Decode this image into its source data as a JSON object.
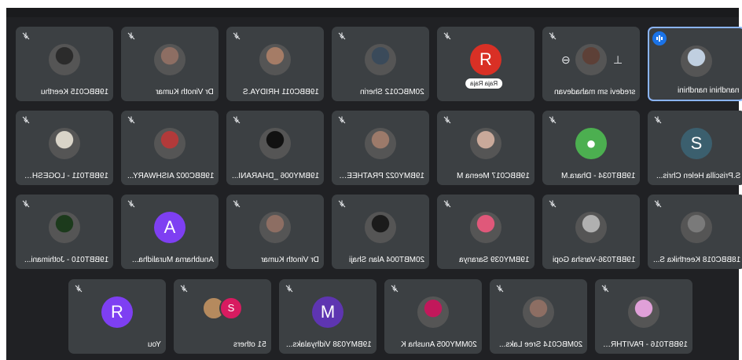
{
  "colors": {
    "tile_bg": "#3c4043",
    "frame_bg": "#202124",
    "speaking_border": "#8ab4f8"
  },
  "rows": [
    [
      {
        "name": "19BBC015 Keerthu",
        "avatar": "photo",
        "tone": "#2b2b2b"
      },
      {
        "name": "Dr Vinoth Kumar",
        "avatar": "photo",
        "tone": "#8d6e63"
      },
      {
        "name": "19BBC011 HRIDYA.S",
        "avatar": "photo",
        "tone": "#a57c66"
      },
      {
        "name": "20MBC012 Sherin",
        "avatar": "photo",
        "tone": "#3a4a5a"
      },
      {
        "name": "",
        "avatar": "letter",
        "letter": "R",
        "letter_color": "#d93025",
        "chip": "Raja Raja"
      },
      {
        "name": "sredevi sm mahadevan",
        "avatar": "photo",
        "tone": "#5d4037",
        "hover": true
      },
      {
        "name": "nandhini nandhini",
        "avatar": "photo",
        "tone": "#c0cfe0",
        "speaking": true
      }
    ],
    [
      {
        "name": "19BBT011 - LOGESHW...",
        "avatar": "photo",
        "tone": "#d9d4c8"
      },
      {
        "name": "19BBC002 AISHWARY...",
        "avatar": "photo",
        "tone": "#b23a3a"
      },
      {
        "name": "19BMY006 _DHARANI...",
        "avatar": "photo",
        "tone": "#111111"
      },
      {
        "name": "19BMY022 PRATHEEP...",
        "avatar": "photo",
        "tone": "#9c7a6a"
      },
      {
        "name": "19BBC017 Meena M",
        "avatar": "photo",
        "tone": "#c9a99a"
      },
      {
        "name": "19BBT034 - Dhara.M",
        "avatar": "letter",
        "letter": "●",
        "letter_color": "#4caf50"
      },
      {
        "name": "S.Priscilla Helen Chris...",
        "avatar": "letter",
        "letter": "S",
        "letter_color": "#3b5f6e"
      }
    ],
    [
      {
        "name": "19BBT010 - Jothimani...",
        "avatar": "photo",
        "tone": "#1c3a1c"
      },
      {
        "name": "Anubharna Muralidha...",
        "avatar": "letter",
        "letter": "A",
        "letter_color": "#7e3ff2"
      },
      {
        "name": "Dr Vinoth Kumar",
        "avatar": "photo",
        "tone": "#8d6e63"
      },
      {
        "name": "20MBT004 Alan Shaji",
        "avatar": "photo",
        "tone": "#1b1b1b"
      },
      {
        "name": "19BMY039 Saranya",
        "avatar": "photo",
        "tone": "#e0587a"
      },
      {
        "name": "19BBT036-Varsha Gopi",
        "avatar": "photo",
        "tone": "#b0b0b0"
      },
      {
        "name": "18BBC018 Keerthika S...",
        "avatar": "photo",
        "tone": "#7a7a7a"
      }
    ],
    [
      {
        "name": "You",
        "avatar": "letter",
        "letter": "R",
        "letter_color": "#7e3ff2"
      },
      {
        "name": "51 others",
        "avatar": "others",
        "others_letter": "S"
      },
      {
        "name": "19BMY038 Vidhyalaks...",
        "avatar": "letter",
        "letter": "M",
        "letter_color": "#5e35b1"
      },
      {
        "name": "20MMY005 Anusha K",
        "avatar": "photo",
        "tone": "#c2185b"
      },
      {
        "name": "20MBC014 Sree Laks...",
        "avatar": "photo",
        "tone": "#8d6e63"
      },
      {
        "name": "19BBT016 - PAVITHRA.V",
        "avatar": "photo",
        "tone": "#e0a0d8"
      }
    ]
  ]
}
